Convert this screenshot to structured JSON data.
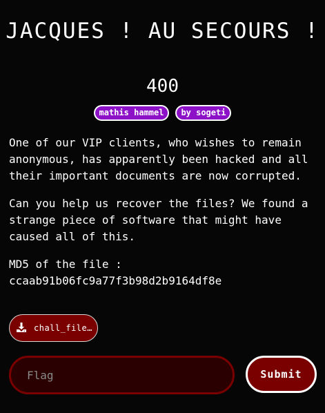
{
  "challenge": {
    "title": "JACQUES ! AU SECOURS !",
    "points": "400",
    "tags": [
      "mathis hammel",
      "by sogeti"
    ],
    "description": [
      "One of our VIP clients, who wishes to remain anonymous, has apparently been hacked and all their important documents are now corrupted.",
      "Can you help us recover the files? We found a strange piece of software that might have caused all of this."
    ],
    "md5_label": "MD5 of the file :",
    "md5_value": "ccaab91b06fc9a77f3b98d2b9164df8e"
  },
  "file": {
    "name": "chall_files.zip",
    "icon": "download-icon"
  },
  "form": {
    "flag_placeholder": "Flag",
    "submit_label": "Submit"
  },
  "colors": {
    "background": "#060606",
    "tag_purple": "#8d12c7",
    "accent_red": "#7a0000"
  }
}
